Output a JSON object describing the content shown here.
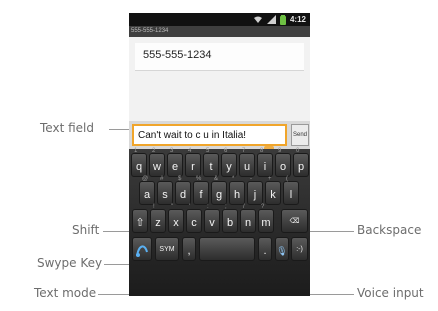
{
  "status_bar": {
    "time": "4:12"
  },
  "title_bar": {
    "text": "555-555-1234"
  },
  "recipient": {
    "value": "555-555-1234"
  },
  "composer": {
    "message": "Can't wait to c u in Italia!",
    "send_label": "Send"
  },
  "keyboard": {
    "row1": [
      {
        "k": "q",
        "s": "1"
      },
      {
        "k": "w",
        "s": "2"
      },
      {
        "k": "e",
        "s": "3"
      },
      {
        "k": "r",
        "s": "4"
      },
      {
        "k": "t",
        "s": "5"
      },
      {
        "k": "y",
        "s": "6"
      },
      {
        "k": "u",
        "s": "7"
      },
      {
        "k": "i",
        "s": "8"
      },
      {
        "k": "o",
        "s": "9"
      },
      {
        "k": "p",
        "s": "0"
      }
    ],
    "row2": [
      {
        "k": "a",
        "s": "@"
      },
      {
        "k": "s",
        "s": "#"
      },
      {
        "k": "d",
        "s": "$"
      },
      {
        "k": "f",
        "s": "%"
      },
      {
        "k": "g",
        "s": "&"
      },
      {
        "k": "h",
        "s": "*"
      },
      {
        "k": "j",
        "s": "-"
      },
      {
        "k": "k",
        "s": "+"
      },
      {
        "k": "l",
        "s": "("
      }
    ],
    "row3": [
      {
        "k": "⇧",
        "s": ""
      },
      {
        "k": "z",
        "s": "!"
      },
      {
        "k": "x",
        "s": "\""
      },
      {
        "k": "c",
        "s": "'"
      },
      {
        "k": "v",
        "s": ":"
      },
      {
        "k": "b",
        "s": ";"
      },
      {
        "k": "n",
        "s": "/"
      },
      {
        "k": "m",
        "s": "?"
      }
    ],
    "backspace": "⌫",
    "sym": "SYM",
    "comma": ",",
    "period": ".",
    "mic": "🎙",
    "smiley": ":-)"
  },
  "callouts": {
    "text_field": "Text field",
    "shift": "Shift",
    "swype_key": "Swype Key",
    "text_mode": "Text mode",
    "backspace": "Backspace",
    "voice_input": "Voice input"
  },
  "colors": {
    "accent": "#f0a52b",
    "key_bg": "#3a3a3a",
    "callout_text": "#6d6d6d"
  }
}
